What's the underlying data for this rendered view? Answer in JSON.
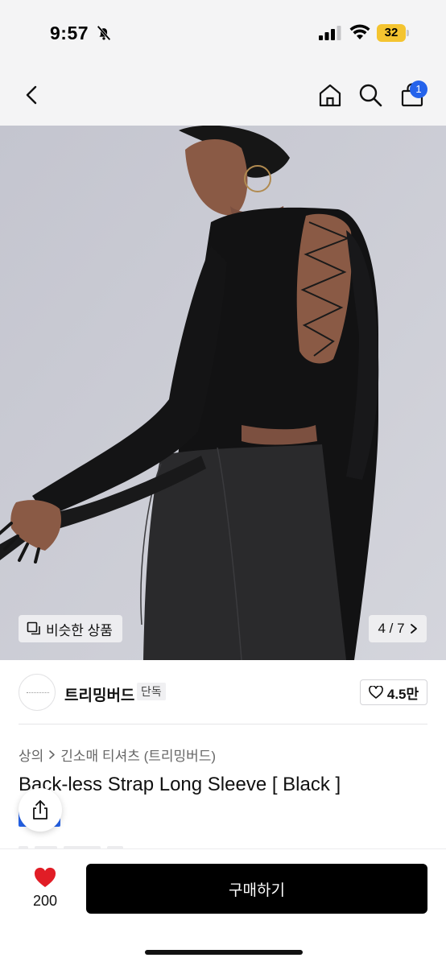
{
  "status": {
    "time": "9:57",
    "battery": "32",
    "icons": [
      "bell-slash-icon",
      "signal-icon",
      "wifi-icon",
      "battery-icon"
    ]
  },
  "nav": {
    "icons": [
      "chevron-left-icon",
      "home-icon",
      "search-icon",
      "cart-icon"
    ],
    "cart_badge": "1"
  },
  "gallery": {
    "similar_label": "비슷한 상품",
    "counter": "4 / 7"
  },
  "seller": {
    "name": "트리밍버드",
    "tag": "단독",
    "likes": "4.5만"
  },
  "product": {
    "breadcrumb": [
      "상의",
      "긴소매 티셔츠 (트리밍버드)"
    ],
    "title": "Back-less Strap Long Sleeve [ Black ]"
  },
  "action_bar": {
    "wish_count": "200",
    "buy_label": "구매하기"
  },
  "colors": {
    "accent_blue": "#2563eb",
    "heart_red": "#e11d26",
    "battery_yellow": "#f4c430",
    "buy_button": "#000000"
  }
}
